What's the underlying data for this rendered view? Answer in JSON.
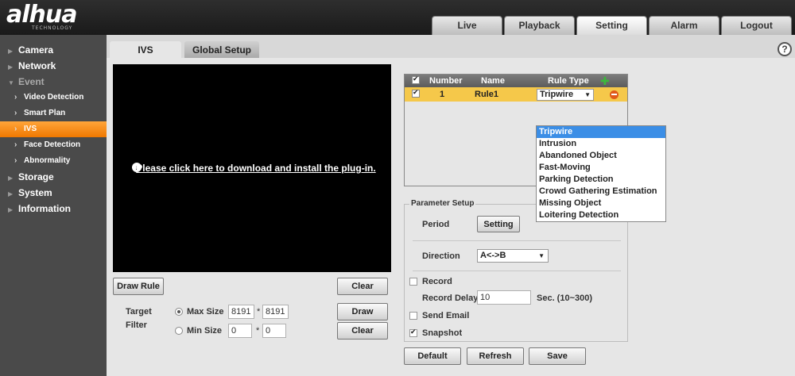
{
  "brand": {
    "logo": "alhua",
    "tagline": "TECHNOLOGY"
  },
  "nav_tabs": [
    {
      "label": "Live"
    },
    {
      "label": "Playback"
    },
    {
      "label": "Setting"
    },
    {
      "label": "Alarm"
    },
    {
      "label": "Logout"
    }
  ],
  "sidebar": {
    "items": [
      {
        "label": "Camera"
      },
      {
        "label": "Network"
      },
      {
        "label": "Event"
      },
      {
        "label": "Video Detection"
      },
      {
        "label": "Smart Plan"
      },
      {
        "label": "IVS"
      },
      {
        "label": "Face Detection"
      },
      {
        "label": "Abnormality"
      },
      {
        "label": "Storage"
      },
      {
        "label": "System"
      },
      {
        "label": "Information"
      }
    ]
  },
  "subtabs": [
    {
      "label": "IVS"
    },
    {
      "label": "Global Setup"
    }
  ],
  "help": "?",
  "video": {
    "plugin_message": "Please click here to download and install the plug-in.",
    "plugin_icon": "download-icon"
  },
  "left_controls": {
    "draw_rule": "Draw Rule",
    "clear_rule": "Clear",
    "target_filter": "Target\nFilter",
    "target_label": "Target",
    "filter_label": "Filter",
    "max_size_label": "Max Size",
    "max_w": "8191",
    "max_h": "8191",
    "min_size_label": "Min Size",
    "min_w": "0",
    "min_h": "0",
    "times": "*",
    "draw_target": "Draw Target",
    "clear_target": "Clear"
  },
  "rule_table": {
    "headers": {
      "number": "Number",
      "name": "Name",
      "rule_type": "Rule Type"
    },
    "rows": [
      {
        "number": "1",
        "name": "Rule1",
        "rule_type": "Tripwire"
      }
    ],
    "caret": "▼"
  },
  "rule_type_options": [
    "Tripwire",
    "Intrusion",
    "Abandoned Object",
    "Fast-Moving",
    "Parking Detection",
    "Crowd Gathering Estimation",
    "Missing Object",
    "Loitering Detection"
  ],
  "param_setup": {
    "legend": "Parameter Setup",
    "period_label": "Period",
    "period_button": "Setting",
    "direction_label": "Direction",
    "direction_value": "A<->B",
    "record_label": "Record",
    "record_delay_label": "Record Delay",
    "record_delay_value": "10",
    "record_delay_hint": "Sec. (10~300)",
    "send_email_label": "Send Email",
    "snapshot_label": "Snapshot"
  },
  "bottom_buttons": {
    "default": "Default",
    "refresh": "Refresh",
    "save": "Save"
  },
  "colors": {
    "accent": "#f07800",
    "row_highlight": "#f5c84a",
    "selected_option": "#3b8ee6"
  }
}
